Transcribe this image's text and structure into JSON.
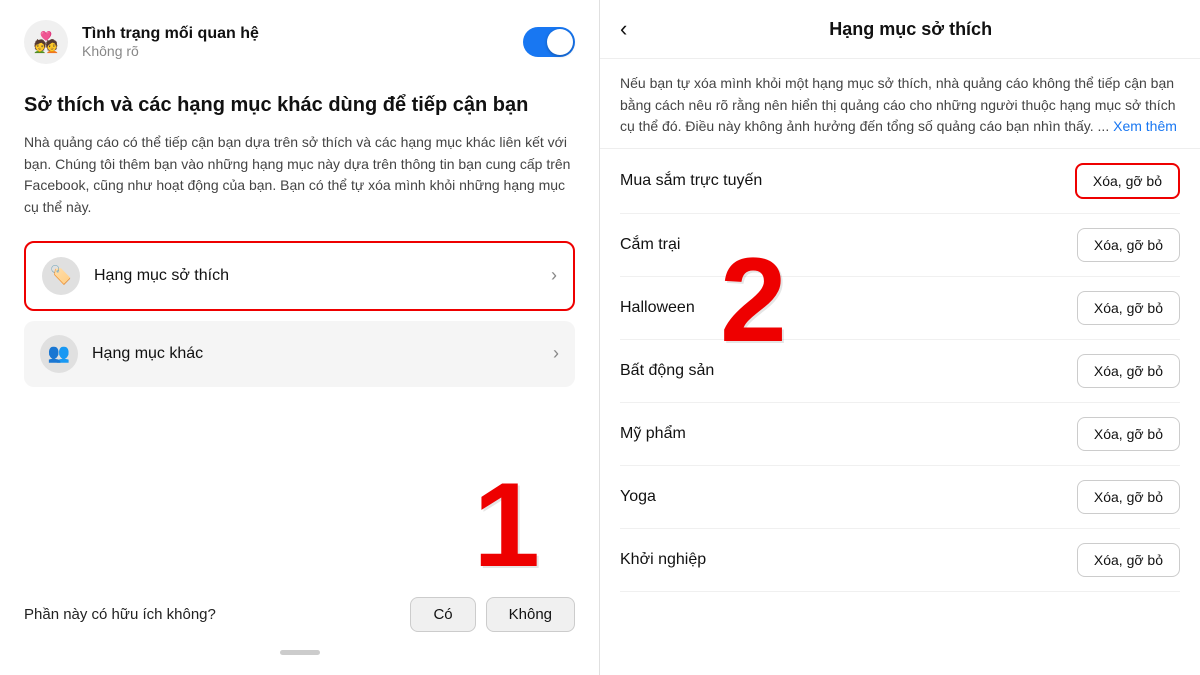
{
  "left": {
    "relationship": {
      "title": "Tình trạng mối quan hệ",
      "subtitle": "Không rõ",
      "toggle_on": true
    },
    "section_heading": "Sở thích và các hạng mục khác dùng để tiếp cận bạn",
    "section_desc": "Nhà quảng cáo có thể tiếp cận bạn dựa trên sở thích và các hạng mục khác liên kết với bạn. Chúng tôi thêm bạn vào những hạng mục này dựa trên thông tin bạn cung cấp trên Facebook, cũng như hoạt động của bạn. Bạn có thể tự xóa mình khỏi những hạng mục cụ thể này.",
    "menu_items": [
      {
        "icon": "🏷️",
        "label": "Hạng mục sở thích",
        "highlighted": true
      },
      {
        "icon": "👥",
        "label": "Hạng mục khác",
        "highlighted": false
      }
    ],
    "helpful_question": "Phần này có hữu ích không?",
    "btn_yes": "Có",
    "btn_no": "Không",
    "number_label": "1"
  },
  "right": {
    "back_label": "‹",
    "title": "Hạng mục sở thích",
    "description": "Nếu bạn tự xóa mình khỏi một hạng mục sở thích, nhà quảng cáo không thể tiếp cận bạn bằng cách nêu rõ rằng nên hiển thị quảng cáo cho những người thuộc hạng mục sở thích cụ thể đó. Điều này không ảnh hưởng đến tổng số quảng cáo bạn nhìn thấy. ...",
    "see_more": "Xem thêm",
    "interests": [
      {
        "name": "Mua sắm trực tuyến",
        "highlighted": true
      },
      {
        "name": "Cắm trại",
        "highlighted": false
      },
      {
        "name": "Halloween",
        "highlighted": false
      },
      {
        "name": "Bất động sản",
        "highlighted": false
      },
      {
        "name": "Mỹ phẩm",
        "highlighted": false
      },
      {
        "name": "Yoga",
        "highlighted": false
      },
      {
        "name": "Khởi nghiệp",
        "highlighted": false
      }
    ],
    "remove_btn_label": "Xóa, gỡ bỏ",
    "number_label": "2"
  }
}
